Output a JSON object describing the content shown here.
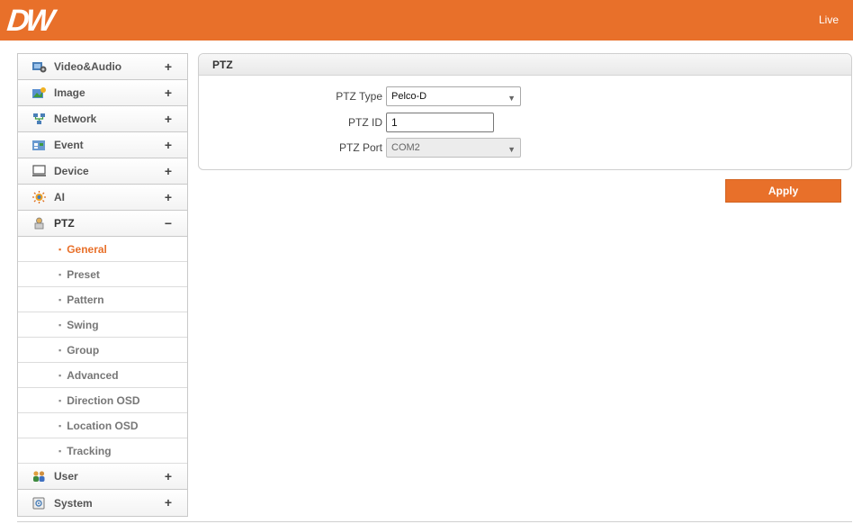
{
  "header": {
    "logo_text": "DW",
    "live_label": "Live",
    "accent_color": "#e8702a"
  },
  "sidebar": {
    "items": [
      {
        "label": "Video&Audio",
        "sign": "+",
        "icon": "video-audio-icon"
      },
      {
        "label": "Image",
        "sign": "+",
        "icon": "image-icon"
      },
      {
        "label": "Network",
        "sign": "+",
        "icon": "network-icon"
      },
      {
        "label": "Event",
        "sign": "+",
        "icon": "event-icon"
      },
      {
        "label": "Device",
        "sign": "+",
        "icon": "device-icon"
      },
      {
        "label": "AI",
        "sign": "+",
        "icon": "ai-icon"
      },
      {
        "label": "PTZ",
        "sign": "−",
        "icon": "ptz-icon"
      },
      {
        "label": "User",
        "sign": "+",
        "icon": "user-icon"
      },
      {
        "label": "System",
        "sign": "+",
        "icon": "system-icon"
      }
    ],
    "ptz_subitems": [
      {
        "label": "General",
        "active": true
      },
      {
        "label": "Preset"
      },
      {
        "label": "Pattern"
      },
      {
        "label": "Swing"
      },
      {
        "label": "Group"
      },
      {
        "label": "Advanced"
      },
      {
        "label": "Direction OSD"
      },
      {
        "label": "Location OSD"
      },
      {
        "label": "Tracking"
      }
    ],
    "bullet": "▪"
  },
  "panel": {
    "title": "PTZ",
    "fields": {
      "ptz_type": {
        "label": "PTZ Type",
        "value": "Pelco-D"
      },
      "ptz_id": {
        "label": "PTZ ID",
        "value": "1"
      },
      "ptz_port": {
        "label": "PTZ Port",
        "value": "COM2"
      }
    },
    "dropdown_arrow": "▼"
  },
  "apply_label": "Apply"
}
